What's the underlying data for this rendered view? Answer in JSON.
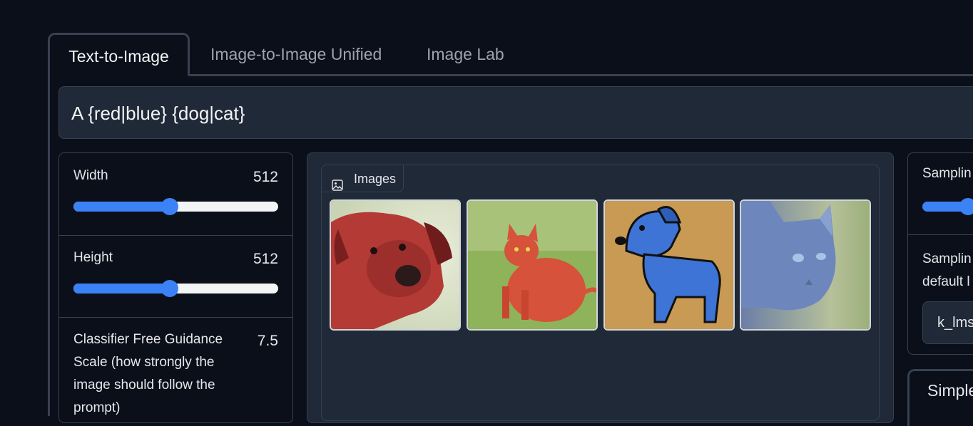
{
  "tabs": [
    "Text-to-Image",
    "Image-to-Image Unified",
    "Image Lab"
  ],
  "prompt": {
    "value": "A {red|blue} {dog|cat}"
  },
  "settings": {
    "width": {
      "label": "Width",
      "value": "512",
      "fraction": 0.47
    },
    "height": {
      "label": "Height",
      "value": "512",
      "fraction": 0.47
    },
    "cfg": {
      "label": "Classifier Free Guidance Scale (how strongly the image should follow the prompt)",
      "value": "7.5"
    }
  },
  "gallery": {
    "label": "Images",
    "images": [
      {
        "name": "red dog",
        "icon": "red-dog-image"
      },
      {
        "name": "red cat",
        "icon": "red-cat-image"
      },
      {
        "name": "blue dog",
        "icon": "blue-dog-image"
      },
      {
        "name": "blue cat",
        "icon": "blue-cat-image"
      }
    ]
  },
  "right": {
    "steps_label": "Samplin",
    "sampler_label_line1": "Samplin",
    "sampler_label_line2": "default l",
    "sampler_value": "k_lms",
    "tab_label": "Simple"
  },
  "colors": {
    "background": "#0b0f19",
    "panel": "#1f2937",
    "border": "#374151",
    "accent": "#3b82f6"
  }
}
